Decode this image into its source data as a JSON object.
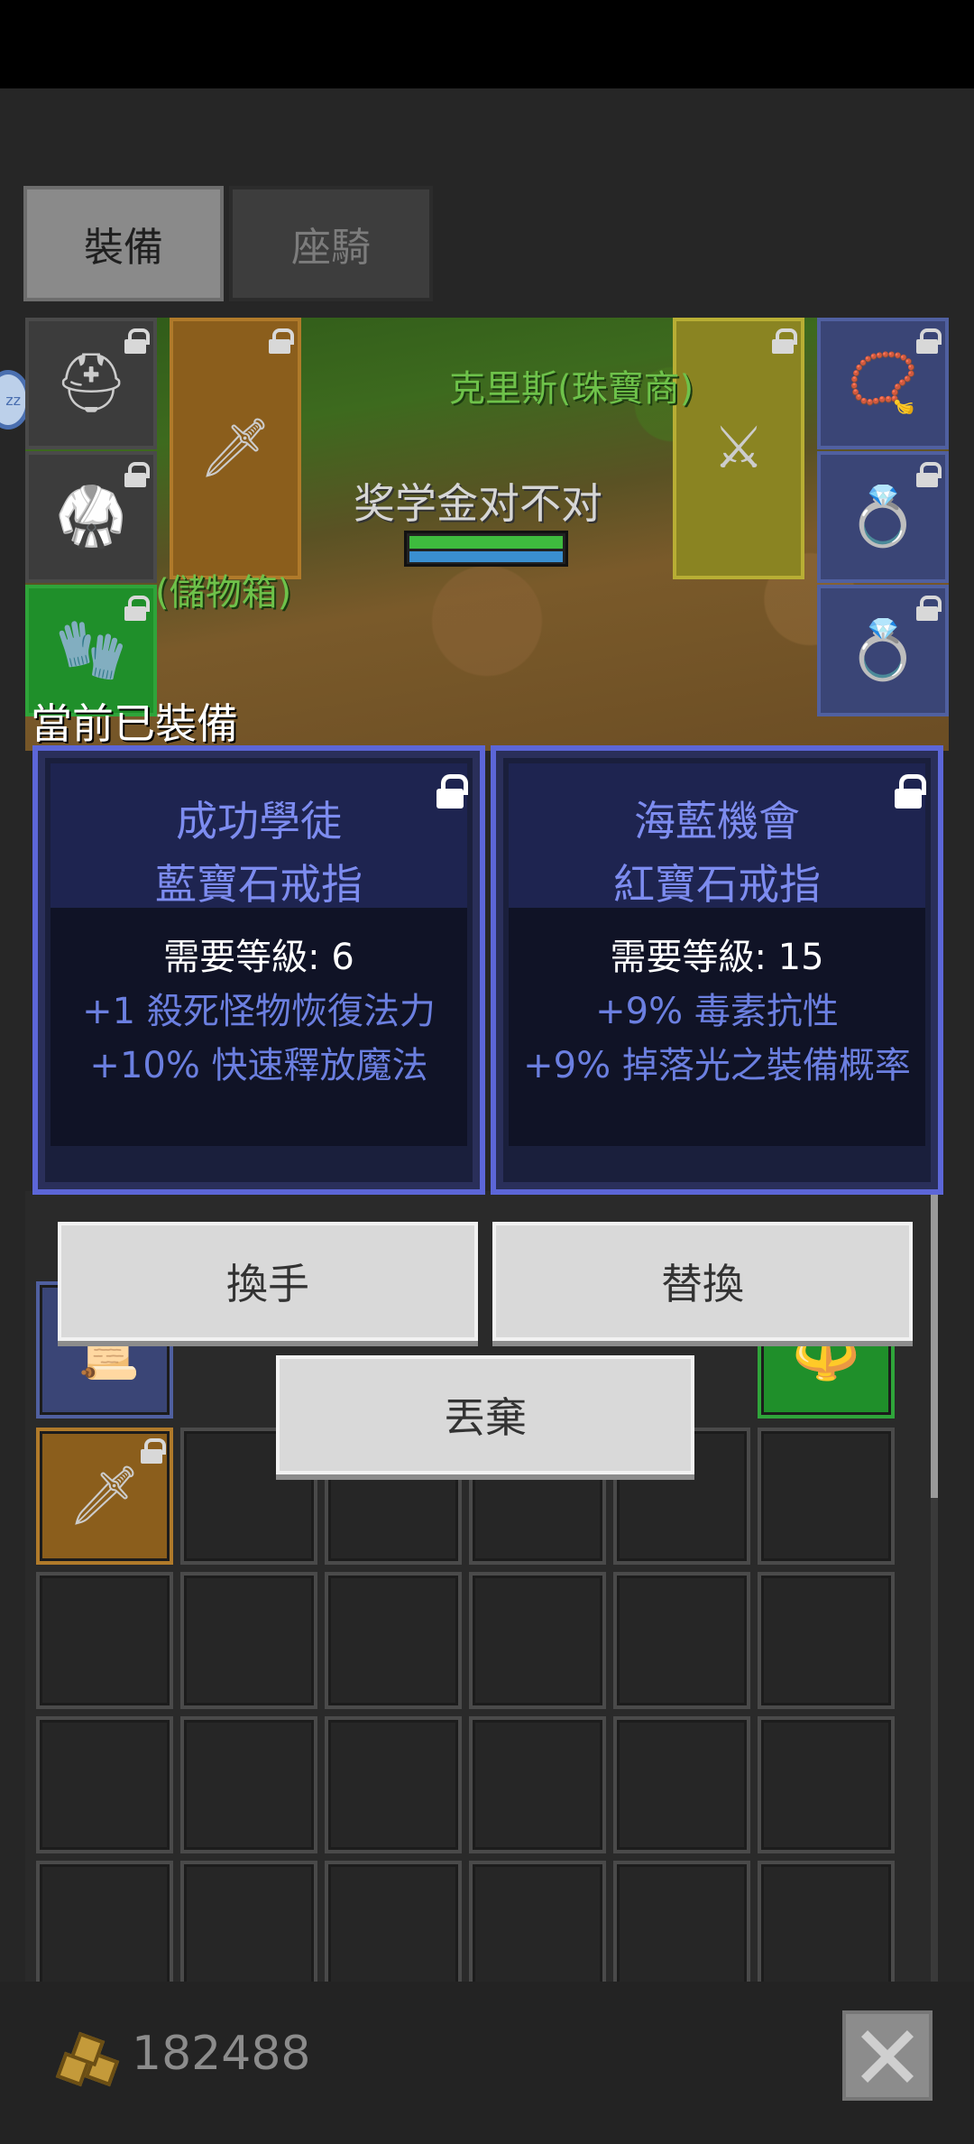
{
  "tabs": {
    "equip": "裝備",
    "mount": "座騎"
  },
  "scene": {
    "npc_name": "克里斯(珠寶商)",
    "player_name": "奖学金对不对",
    "chest_label": "(儲物箱)"
  },
  "equipped_title": "當前已裝備",
  "cards": [
    {
      "name_line1": "成功學徒",
      "name_line2": "藍寶石戒指",
      "requirement": "需要等級: 6",
      "stat1": "+1 殺死怪物恢復法力",
      "stat2": "+10% 快速釋放魔法"
    },
    {
      "name_line1": "海藍機會",
      "name_line2": "紅寶石戒指",
      "requirement": "需要等級: 15",
      "stat1": "+9% 毒素抗性",
      "stat2": "+9% 掉落光之裝備概率"
    }
  ],
  "buttons": {
    "swap_hand": "換手",
    "replace": "替換",
    "discard": "丟棄"
  },
  "gold": "182488",
  "side_badge": "zz",
  "colors": {
    "card_border": "#5c66d8",
    "card_text": "#7d8cf0",
    "name_green": "#6ec24a"
  }
}
